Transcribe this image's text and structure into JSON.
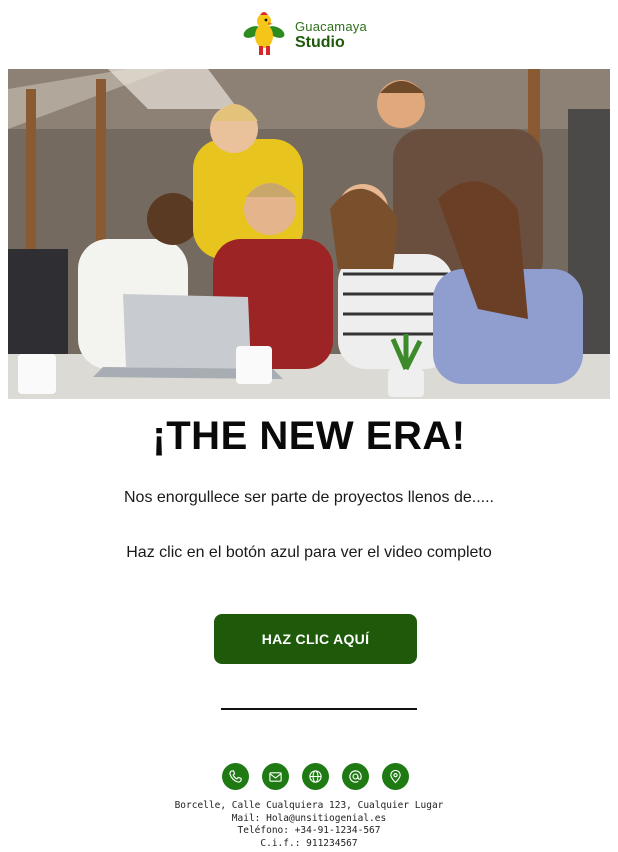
{
  "brand": {
    "name_top": "Guacamaya",
    "name_bottom": "Studio",
    "colors": {
      "primary": "#1f5a0a",
      "icon_green": "#1f7a14"
    }
  },
  "hero": {
    "image": "group-celebrating-at-laptop"
  },
  "headline": "¡THE NEW ERA!",
  "body": {
    "paragraph_1": "Nos enorgullece ser parte de proyectos llenos de.....",
    "paragraph_2": "Haz clic en el botón azul para ver el video completo"
  },
  "cta": {
    "label": "HAZ CLIC AQUÍ"
  },
  "contact_icons": [
    "phone-icon",
    "mail-icon",
    "globe-icon",
    "at-icon",
    "location-pin-icon"
  ],
  "footer": {
    "address": "Borcelle, Calle Cualquiera 123, Cualquier Lugar",
    "mail": "Mail: Hola@unsitiogenial.es",
    "phone": "Teléfono: +34-91-1234-567",
    "cif": "C.i.f.: 911234567"
  }
}
